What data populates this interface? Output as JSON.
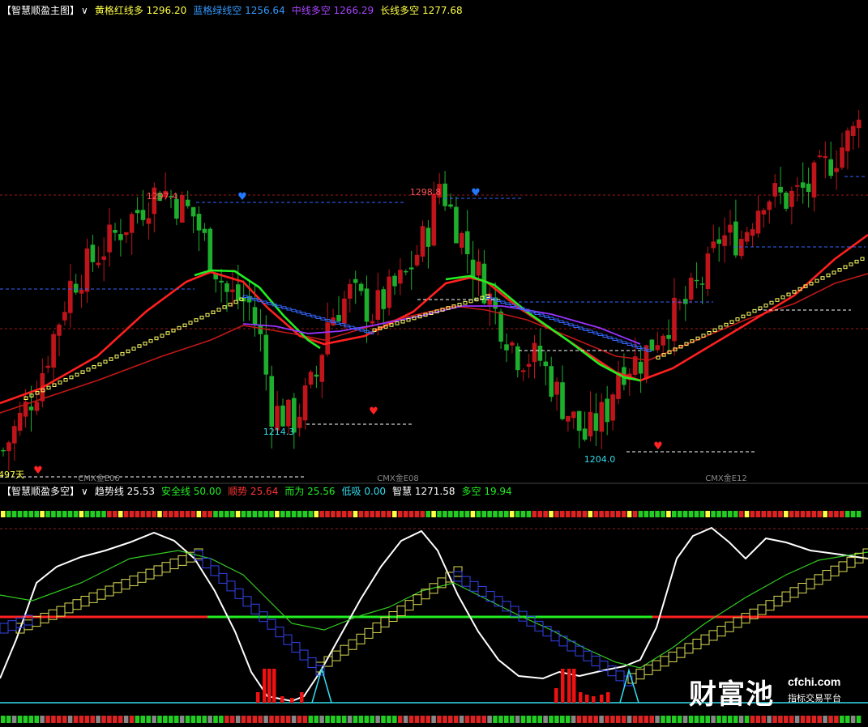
{
  "colors": {
    "up": "#c0141b",
    "down": "#1cae2c",
    "bg": "#000000",
    "yellow": "#ffff66",
    "red_line": "#ff2020",
    "green_line": "#22ee22",
    "purple_line": "#9933ff",
    "blue_dash": "#3366ff",
    "cyan": "#33ddee",
    "white": "#ffffff"
  },
  "main": {
    "header": [
      {
        "text": "【智慧顺盈主图】",
        "color": "#ffffff"
      },
      {
        "text": "∨",
        "color": "#ffffff"
      },
      {
        "text": "黄格红线多 1296.20",
        "color": "#ffff44"
      },
      {
        "text": "蓝格绿线空 1256.64",
        "color": "#3399ff"
      },
      {
        "text": "中线多空 1266.29",
        "color": "#aa44ff"
      },
      {
        "text": "长线多空 1277.68",
        "color": "#ffff44"
      }
    ],
    "annotations": [
      {
        "text": "1297.4",
        "color": "#ff5555"
      },
      {
        "text": "1298.8",
        "color": "#ff5555"
      },
      {
        "text": "1214.3",
        "color": "#33ddee"
      },
      {
        "text": "1204.0",
        "color": "#33ddee"
      },
      {
        "text": "497天",
        "color": "#ffff44"
      }
    ],
    "contract_labels": [
      "CMX金E06",
      "CMX金E08",
      "CMX金E12"
    ]
  },
  "sub": {
    "header": [
      {
        "text": "【智慧顺盈多空】",
        "color": "#ffffff"
      },
      {
        "text": "∨",
        "color": "#ffffff"
      },
      {
        "text": "趋势线 25.53",
        "color": "#ffffff"
      },
      {
        "text": "安全线 50.00",
        "color": "#22ee22"
      },
      {
        "text": "顺势 25.64",
        "color": "#ff3333"
      },
      {
        "text": "而为 25.56",
        "color": "#22ee22"
      },
      {
        "text": "低吸 0.00",
        "color": "#33ddee"
      },
      {
        "text": "智慧 1271.58",
        "color": "#ffffff"
      },
      {
        "text": "多空 19.94",
        "color": "#22ee22"
      }
    ]
  },
  "watermark": {
    "brand": "财富池",
    "site": "cfchi.com",
    "tagline": "指标交易平台"
  },
  "chart_data": {
    "type": "candlestick",
    "price_levels": {
      "high_1": 1297.4,
      "high_2": 1298.8,
      "low_1": 1214.3,
      "low_2": 1204.0
    },
    "indicators": {
      "黄格红线多": 1296.2,
      "蓝格绿线空": 1256.64,
      "中线多空": 1266.29,
      "长线多空": 1277.68,
      "趋势线": 25.53,
      "安全线": 50.0,
      "顺势": 25.64,
      "而为": 25.56,
      "低吸": 0.0,
      "智慧": 1271.58,
      "多空": 19.94
    }
  }
}
